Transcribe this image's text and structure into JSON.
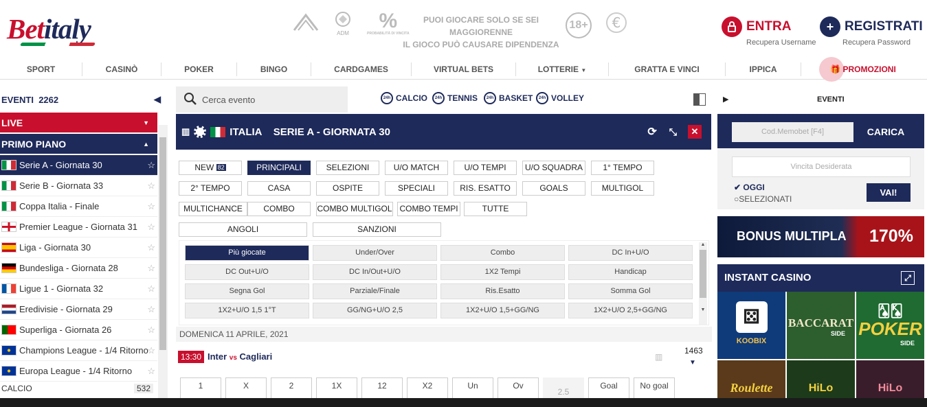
{
  "header": {
    "logo": {
      "part1": "Bet",
      "part2": "italy"
    },
    "reg_icons": [
      "ADM",
      "%"
    ],
    "reg_captions": {
      "adm": "ADM",
      "pct": "PROBABILITÀ DI VINCITA"
    },
    "warning_line1": "PUOI GIOCARE SOLO SE SEI MAGGIORENNE",
    "warning_line2": "IL GIOCO PUÒ CAUSARE DIPENDENZA",
    "age_badge": "18+",
    "entra_label": "ENTRA",
    "entra_sub": "Recupera Username",
    "registrati_label": "REGISTRATI",
    "registrati_sub": "Recupera Password"
  },
  "nav": {
    "items": [
      "SPORT",
      "CASINÒ",
      "POKER",
      "BINGO",
      "CARDGAMES",
      "VIRTUAL BETS",
      "LOTTERIE",
      "GRATTA E VINCI",
      "IPPICA",
      "PROMOZIONI"
    ]
  },
  "sidebar": {
    "events_label": "EVENTI",
    "events_count": "2262",
    "live_label": "LIVE",
    "primo_piano_label": "PRIMO PIANO",
    "leagues": [
      {
        "name": "Serie A - Giornata 30"
      },
      {
        "name": "Serie B - Giornata 33"
      },
      {
        "name": "Coppa Italia - Finale"
      },
      {
        "name": "Premier League - Giornata 31"
      },
      {
        "name": "Liga - Giornata 30"
      },
      {
        "name": "Bundesliga - Giornata 28"
      },
      {
        "name": "Ligue 1 - Giornata 32"
      },
      {
        "name": "Eredivisie - Giornata 29"
      },
      {
        "name": "Superliga - Giornata 26"
      },
      {
        "name": "Champions League - 1/4 Ritorno"
      },
      {
        "name": "Europa League - 1/4 Ritorno"
      }
    ],
    "next_section": "CALCIO",
    "next_count": "532"
  },
  "center": {
    "search_placeholder": "Cerca evento",
    "sport_quick": [
      "CALCIO",
      "TENNIS",
      "BASKET",
      "VOLLEY"
    ],
    "quick_icon_text": "24h",
    "title_country": "ITALIA",
    "title_league": "SERIE A - GIORNATA 30",
    "new_badge": "82",
    "tabs_row1": [
      "NEW",
      "PRINCIPALI",
      "SELEZIONI",
      "U/O MATCH",
      "U/O TEMPI",
      "U/O SQUADRA",
      "1° TEMPO"
    ],
    "tabs_row2": [
      "2° TEMPO",
      "CASA",
      "OSPITE",
      "SPECIALI",
      "RIS. ESATTO",
      "GOALS",
      "MULTIGOL"
    ],
    "tabs_row3": [
      "MULTICHANCE",
      "COMBO",
      "COMBO MULTIGOL",
      "COMBO TEMPI",
      "TUTTE"
    ],
    "tabs_row4": [
      "ANGOLI",
      "SANZIONI"
    ],
    "sub_markets": [
      [
        "Più giocate",
        "Under/Over",
        "Combo",
        "DC In+U/O"
      ],
      [
        "DC Out+U/O",
        "DC In/Out+U/O",
        "1X2 Tempi",
        "Handicap"
      ],
      [
        "Segna Gol",
        "Parziale/Finale",
        "Ris.Esatto",
        "Somma Gol"
      ],
      [
        "1X2+U/O 1,5 1°T",
        "GG/NG+U/O 2,5",
        "1X2+U/O 1,5+GG/NG",
        "1X2+U/O 2,5+GG/NG"
      ]
    ],
    "date_label": "DOMENICA 11 APRILE, 2021",
    "match": {
      "time": "13:30",
      "home": "Inter",
      "vs": "vs",
      "away": "Cagliari",
      "count": "1463"
    },
    "odds_headers": [
      "1",
      "X",
      "2",
      "1X",
      "12",
      "X2",
      "Un",
      "Ov",
      "2.5",
      "Goal",
      "No goal"
    ]
  },
  "right": {
    "events_label": "EVENTI",
    "memobet_placeholder": "Cod.Memobet [F4]",
    "carica_label": "CARICA",
    "vincita_placeholder": "Vincita Desiderata",
    "oggi_label": "OGGI",
    "selezionati_label": "SELEZIONATI",
    "vai_label": "VAI!",
    "bonus_label": "BONUS MULTIPLA",
    "bonus_value": "170%",
    "instant_casino_label": "INSTANT CASINO",
    "games": [
      "KOOBIX",
      "BACCARAT",
      "POKER",
      "Roulette",
      "HiLo",
      "HiLo"
    ],
    "game_side": "SIDE"
  },
  "colors": {
    "brand_navy": "#1e2a5a",
    "brand_red": "#c8102e"
  }
}
